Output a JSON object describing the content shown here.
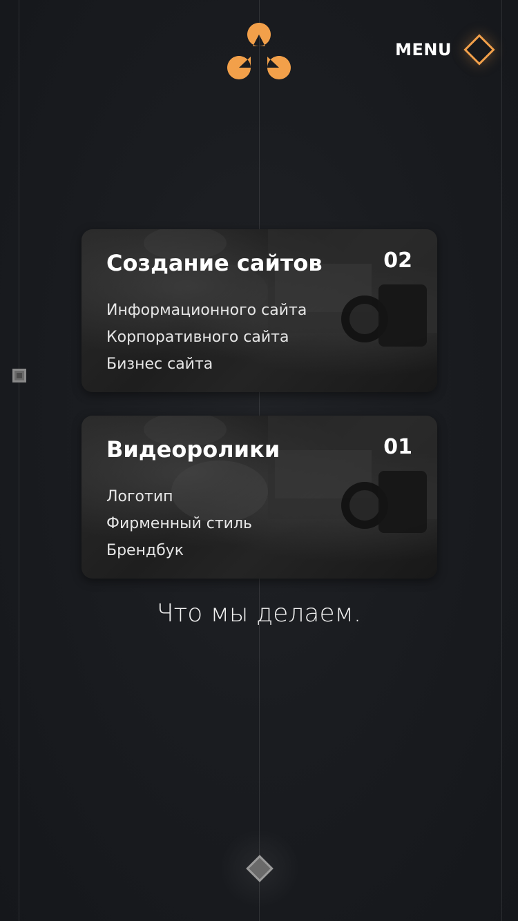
{
  "header": {
    "menu_label": "MENU"
  },
  "cards": [
    {
      "title": "Создание сайтов",
      "number": "02",
      "items": [
        "Информационного сайта",
        "Корпоративного сайта",
        "Бизнес сайта"
      ]
    },
    {
      "title": "Видеоролики",
      "number": "01",
      "items": [
        "Логотип",
        "Фирменный стиль",
        "Брендбук"
      ]
    }
  ],
  "section": {
    "title": "Что мы делаем."
  },
  "colors": {
    "accent": "#f2a04a",
    "background": "#1a1c20"
  },
  "icons": {
    "logo": "three-circle-logo-icon",
    "menu": "diamond-menu-icon",
    "scroll": "diamond-scroll-icon",
    "side_marker": "square-marker-icon"
  }
}
